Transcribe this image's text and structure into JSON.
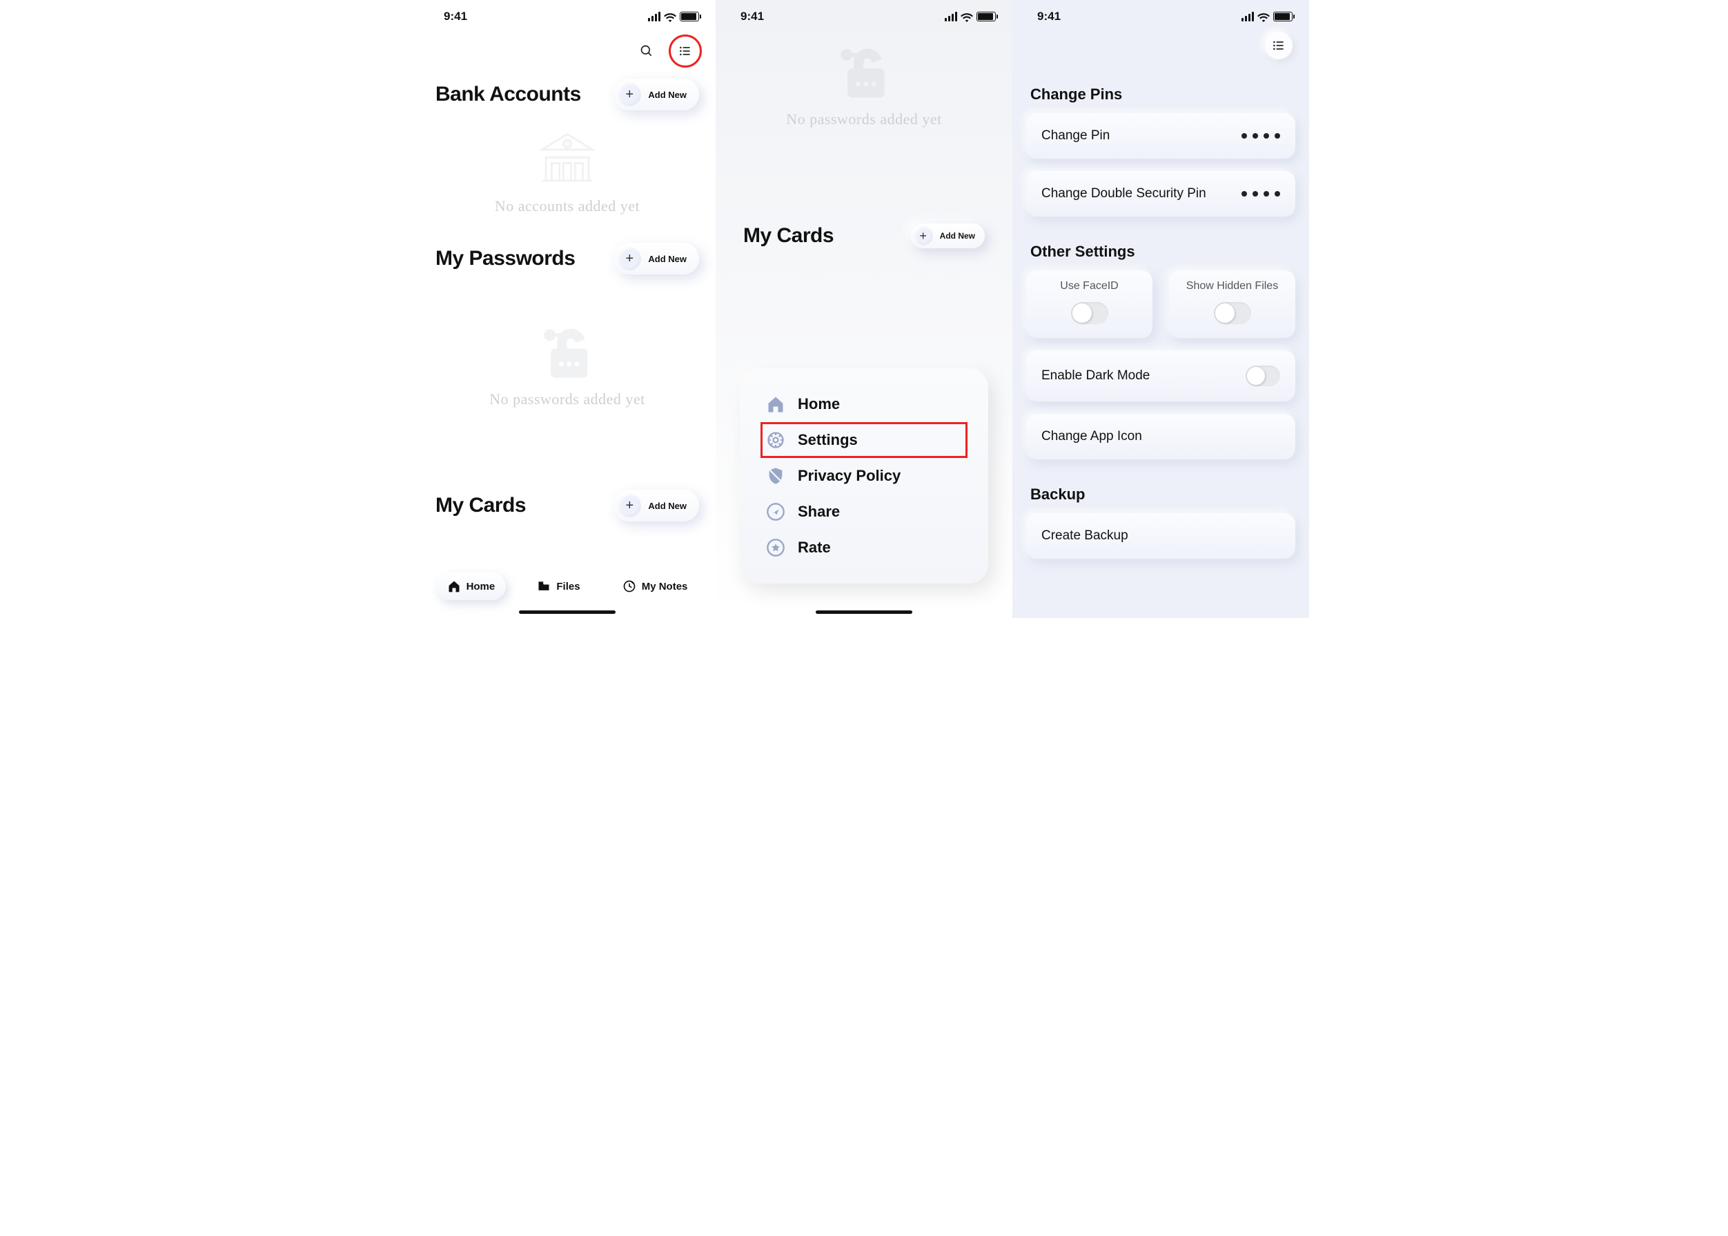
{
  "statusbar": {
    "time": "9:41"
  },
  "screen1": {
    "sections": {
      "bank": {
        "title": "Bank Accounts",
        "add_label": "Add New",
        "empty": "No accounts added yet"
      },
      "passwords": {
        "title": "My Passwords",
        "add_label": "Add New",
        "empty": "No passwords added yet"
      },
      "cards": {
        "title": "My Cards",
        "add_label": "Add New"
      }
    },
    "tabs": {
      "home": "Home",
      "files": "Files",
      "notes": "My Notes"
    }
  },
  "screen2": {
    "passwords_empty": "No passwords added yet",
    "cards": {
      "title": "My Cards",
      "add_label": "Add New"
    },
    "menu": {
      "home": "Home",
      "settings": "Settings",
      "privacy": "Privacy Policy",
      "share": "Share",
      "rate": "Rate"
    }
  },
  "screen3": {
    "sections": {
      "change_pins": "Change Pins",
      "other": "Other Settings",
      "backup": "Backup"
    },
    "rows": {
      "change_pin": "Change Pin",
      "change_double_pin": "Change Double Security Pin",
      "use_faceid": "Use FaceID",
      "show_hidden": "Show Hidden Files",
      "dark_mode": "Enable Dark Mode",
      "app_icon": "Change App Icon",
      "create_backup": "Create Backup"
    }
  }
}
